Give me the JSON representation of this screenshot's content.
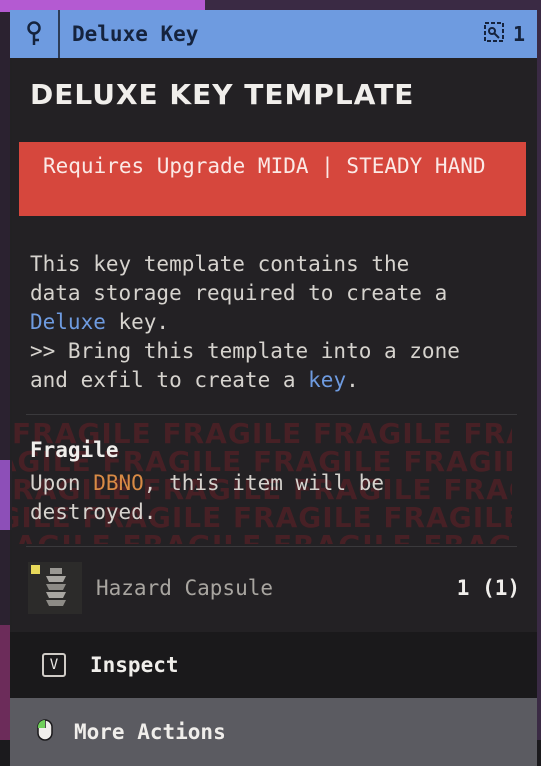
{
  "header": {
    "title": "Deluxe Key",
    "count": "1",
    "icons": {
      "left": "key-icon",
      "right": "linked-item-icon"
    }
  },
  "item": {
    "title": "DELUXE KEY TEMPLATE",
    "requirement": "Requires Upgrade MIDA | STEADY HAND",
    "description": {
      "line1": "This key template contains the",
      "line2a": "data storage required to create a",
      "highlight1": "Deluxe",
      "line2b": " key.",
      "line3": ">> Bring this template into a zone",
      "line4a": "and exfil to create a ",
      "highlight2": "key",
      "line4b": "."
    }
  },
  "fragile": {
    "label": "Fragile",
    "desc_a": "Upon ",
    "dbno": "DBNO",
    "desc_b": ", this item will be destroyed.",
    "watermark": "FRAGILE FRAGILE FRAGILE FRAGILE FRAGILE"
  },
  "required_item": {
    "name": "Hazard Capsule",
    "quantity": "1 (1)"
  },
  "actions": {
    "inspect_key": "V",
    "inspect_label": "Inspect",
    "more_label": "More Actions"
  },
  "colors": {
    "header_bg": "#6e9be0",
    "requirement_bg": "#d6473d",
    "highlight": "#6e9be0",
    "dbno": "#d88a45",
    "panel_bg": "#222123",
    "more_actions_bg": "#5b5b61"
  }
}
